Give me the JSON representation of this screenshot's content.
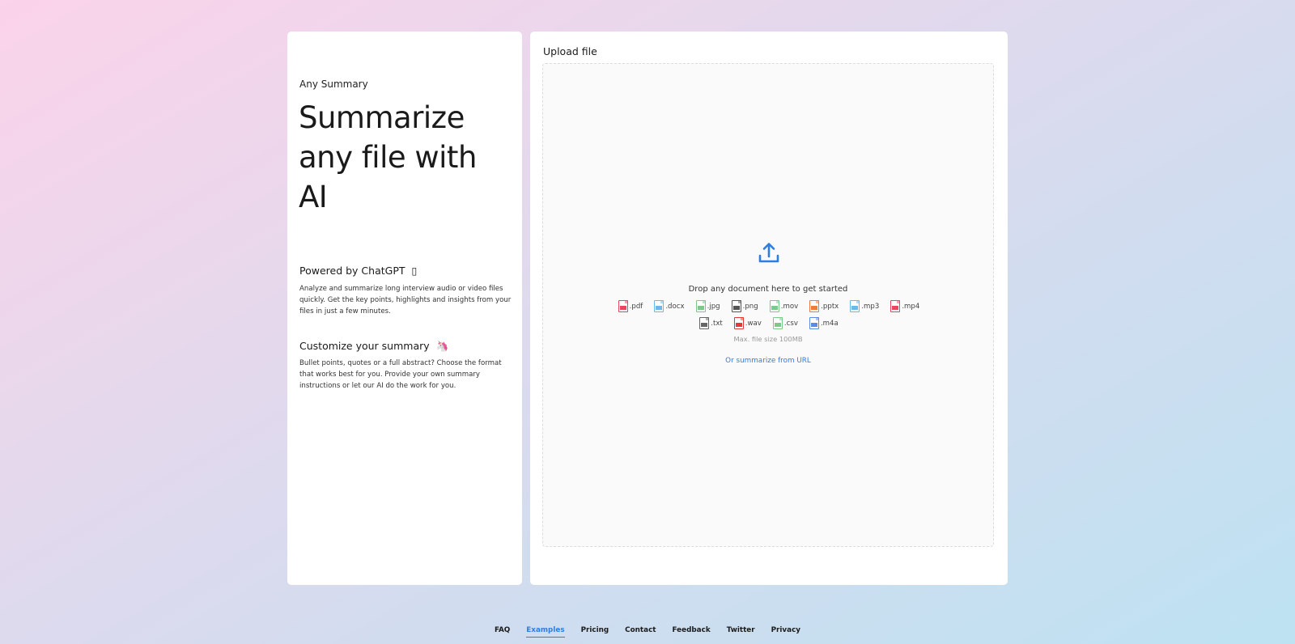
{
  "left_panel": {
    "brand": "Any Summary",
    "hero_title": "Summarize any file with AI",
    "features": [
      {
        "title": "Powered by ChatGPT",
        "emoji": "▯",
        "description": "Analyze and summarize long interview audio or video files quickly. Get the key points, highlights and insights from your files in just a few minutes."
      },
      {
        "title": "Customize your summary",
        "emoji": "🦄",
        "description": "Bullet points, quotes or a full abstract? Choose the format that works best for you. Provide your own summary instructions or let our AI do the work for you."
      }
    ]
  },
  "upload": {
    "title": "Upload file",
    "icon": "upload-icon",
    "drop_text": "Drop any document here to get started",
    "file_types_row1": [
      {
        "ext": ".pdf",
        "color": "#e8475f"
      },
      {
        "ext": ".docx",
        "color": "#6fb7e6"
      },
      {
        "ext": ".jpg",
        "color": "#7cc98c"
      },
      {
        "ext": ".png",
        "color": "#555555"
      },
      {
        "ext": ".mov",
        "color": "#7cc98c"
      },
      {
        "ext": ".pptx",
        "color": "#f27b3a"
      },
      {
        "ext": ".mp3",
        "color": "#6fb7e6"
      },
      {
        "ext": ".mp4",
        "color": "#e8475f"
      }
    ],
    "file_types_row2": [
      {
        "ext": ".txt",
        "color": "#666666"
      },
      {
        "ext": ".wav",
        "color": "#e23a3a"
      },
      {
        "ext": ".csv",
        "color": "#7cc98c"
      },
      {
        "ext": ".m4a",
        "color": "#5a8de0"
      }
    ],
    "max_size": "Max. file size 100MB",
    "url_link": "Or summarize from URL"
  },
  "footer": {
    "links": [
      "FAQ",
      "Examples",
      "Pricing",
      "Contact",
      "Feedback",
      "Twitter",
      "Privacy"
    ],
    "active": "Examples"
  },
  "colors": {
    "accent": "#2f7de1"
  }
}
